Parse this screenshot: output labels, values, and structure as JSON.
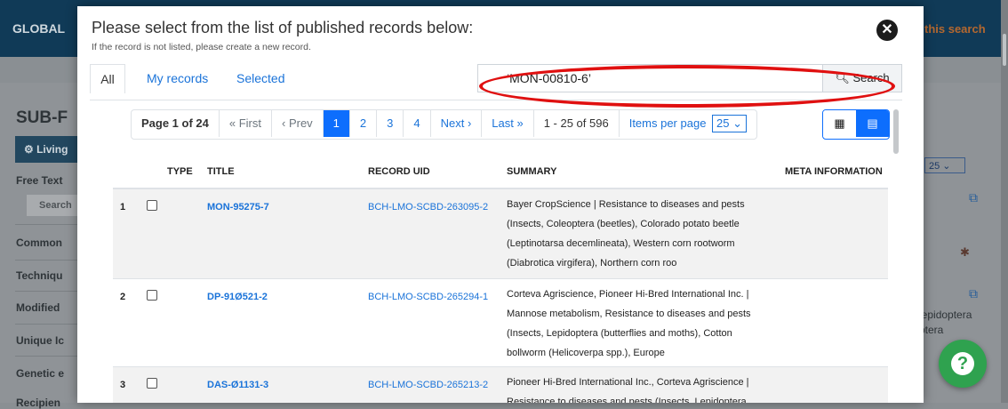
{
  "background": {
    "brand": "GLOBAL",
    "header_link": "this search",
    "section_title": "SUB-F",
    "living_label": "Living",
    "side_labels": [
      "Free Text",
      "Common",
      "Techniqu",
      "Modified",
      "Unique Ic",
      "Genetic e",
      "Recipien"
    ],
    "side_search_label": "Search",
    "items_per_page": "25",
    "lepi_1": "Lepidoptera",
    "lepi_2": "ptera"
  },
  "modal": {
    "title": "Please select from the list of published records below:",
    "subtitle": "If the record is not listed, please create a new record.",
    "tabs": [
      "All",
      "My records",
      "Selected"
    ],
    "search": {
      "value": "‘MON-00810-6’",
      "button_label": "Search"
    },
    "pagination": {
      "page_info": "Page 1 of 24",
      "first": "« First",
      "prev": "‹ Prev",
      "pages": [
        "1",
        "2",
        "3",
        "4"
      ],
      "next": "Next ›",
      "last": "Last »",
      "range": "1 - 25 of 596",
      "items_per_page_label": "Items per page",
      "items_per_page_value": "25"
    },
    "table": {
      "headers": [
        "TYPE",
        "TITLE",
        "RECORD UID",
        "SUMMARY",
        "META INFORMATION"
      ],
      "rows": [
        {
          "num": "1",
          "title": "MON-95275-7",
          "uid": "BCH-LMO-SCBD-263095-2",
          "summary_lines": [
            "Bayer CropScience | Resistance to diseases and pests",
            "(Insects, Coleoptera (beetles), Colorado potato beetle",
            "(Leptinotarsa decemlineata), Western corn rootworm",
            "(Diabrotica virgifera), Northern corn roo"
          ]
        },
        {
          "num": "2",
          "title": "DP-91Ø521-2",
          "uid": "BCH-LMO-SCBD-265294-1",
          "summary_lines": [
            "Corteva Agriscience, Pioneer Hi-Bred International Inc. |",
            "Mannose metabolism, Resistance to diseases and pests",
            "(Insects, Lepidoptera (butterflies and moths), Cotton",
            "bollworm (Helicoverpa spp.), Europe"
          ]
        },
        {
          "num": "3",
          "title": "DAS-Ø1131-3",
          "uid": "BCH-LMO-SCBD-265213-2",
          "summary_lines": [
            "Pioneer Hi-Bred International Inc., Corteva Agriscience |",
            "Resistance to diseases and pests (Insects, Lepidoptera"
          ]
        }
      ]
    }
  }
}
